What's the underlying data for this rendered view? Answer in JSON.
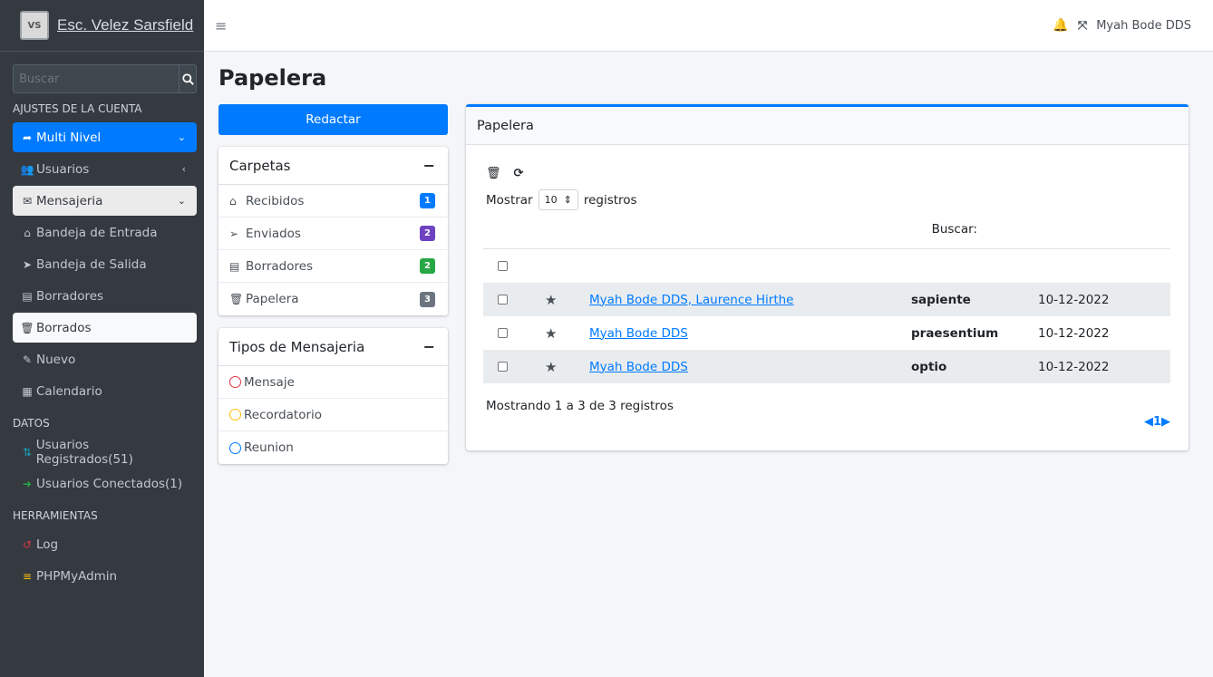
{
  "brand": {
    "title": "Esc. Velez Sarsfield",
    "logo_text": "VS"
  },
  "sidebar": {
    "search_placeholder": "Buscar",
    "sections": {
      "account": "AJUSTES DE LA CUENTA",
      "data": "DATOS",
      "tools": "HERRAMIENTAS"
    },
    "items": {
      "multinivel": "Multi Nivel",
      "usuarios": "Usuarios",
      "mensajeria": "Mensajeria",
      "bandeja_entrada": "Bandeja de Entrada",
      "bandeja_salida": "Bandeja de Salida",
      "borradores": "Borradores",
      "borrados": "Borrados",
      "nuevo": "Nuevo",
      "calendario": "Calendario",
      "usuarios_registrados": "Usuarios Registrados(51)",
      "usuarios_conectados": "Usuarios Conectados(1)",
      "log": "Log",
      "phpmyadmin": "PHPMyAdmin"
    }
  },
  "topbar": {
    "user": "Myah Bode DDS"
  },
  "page": {
    "title": "Papelera",
    "compose": "Redactar"
  },
  "folders": {
    "title": "Carpetas",
    "items": [
      {
        "label": "Recibidos",
        "count": "1",
        "color": "#007bff"
      },
      {
        "label": "Enviados",
        "count": "2",
        "color": "#6f42c1"
      },
      {
        "label": "Borradores",
        "count": "2",
        "color": "#28a745"
      },
      {
        "label": "Papelera",
        "count": "3",
        "color": "#6c757d"
      }
    ]
  },
  "types": {
    "title": "Tipos de Mensajeria",
    "items": [
      {
        "label": "Mensaje",
        "color": "#dc3545"
      },
      {
        "label": "Recordatorio",
        "color": "#ffc107"
      },
      {
        "label": "Reunion",
        "color": "#007bff"
      }
    ]
  },
  "main": {
    "title": "Papelera",
    "show_prefix": "Mostrar",
    "page_size": "10",
    "show_suffix": "registros",
    "search_label": "Buscar:",
    "rows": [
      {
        "from": "Myah Bode DDS, Laurence Hirthe",
        "subject": "sapiente",
        "date": "10-12-2022"
      },
      {
        "from": "Myah Bode DDS",
        "subject": "praesentium",
        "date": "10-12-2022"
      },
      {
        "from": "Myah Bode DDS",
        "subject": "optio",
        "date": "10-12-2022"
      }
    ],
    "info": "Mostrando 1 a 3 de 3 registros",
    "pager_page": "1"
  }
}
